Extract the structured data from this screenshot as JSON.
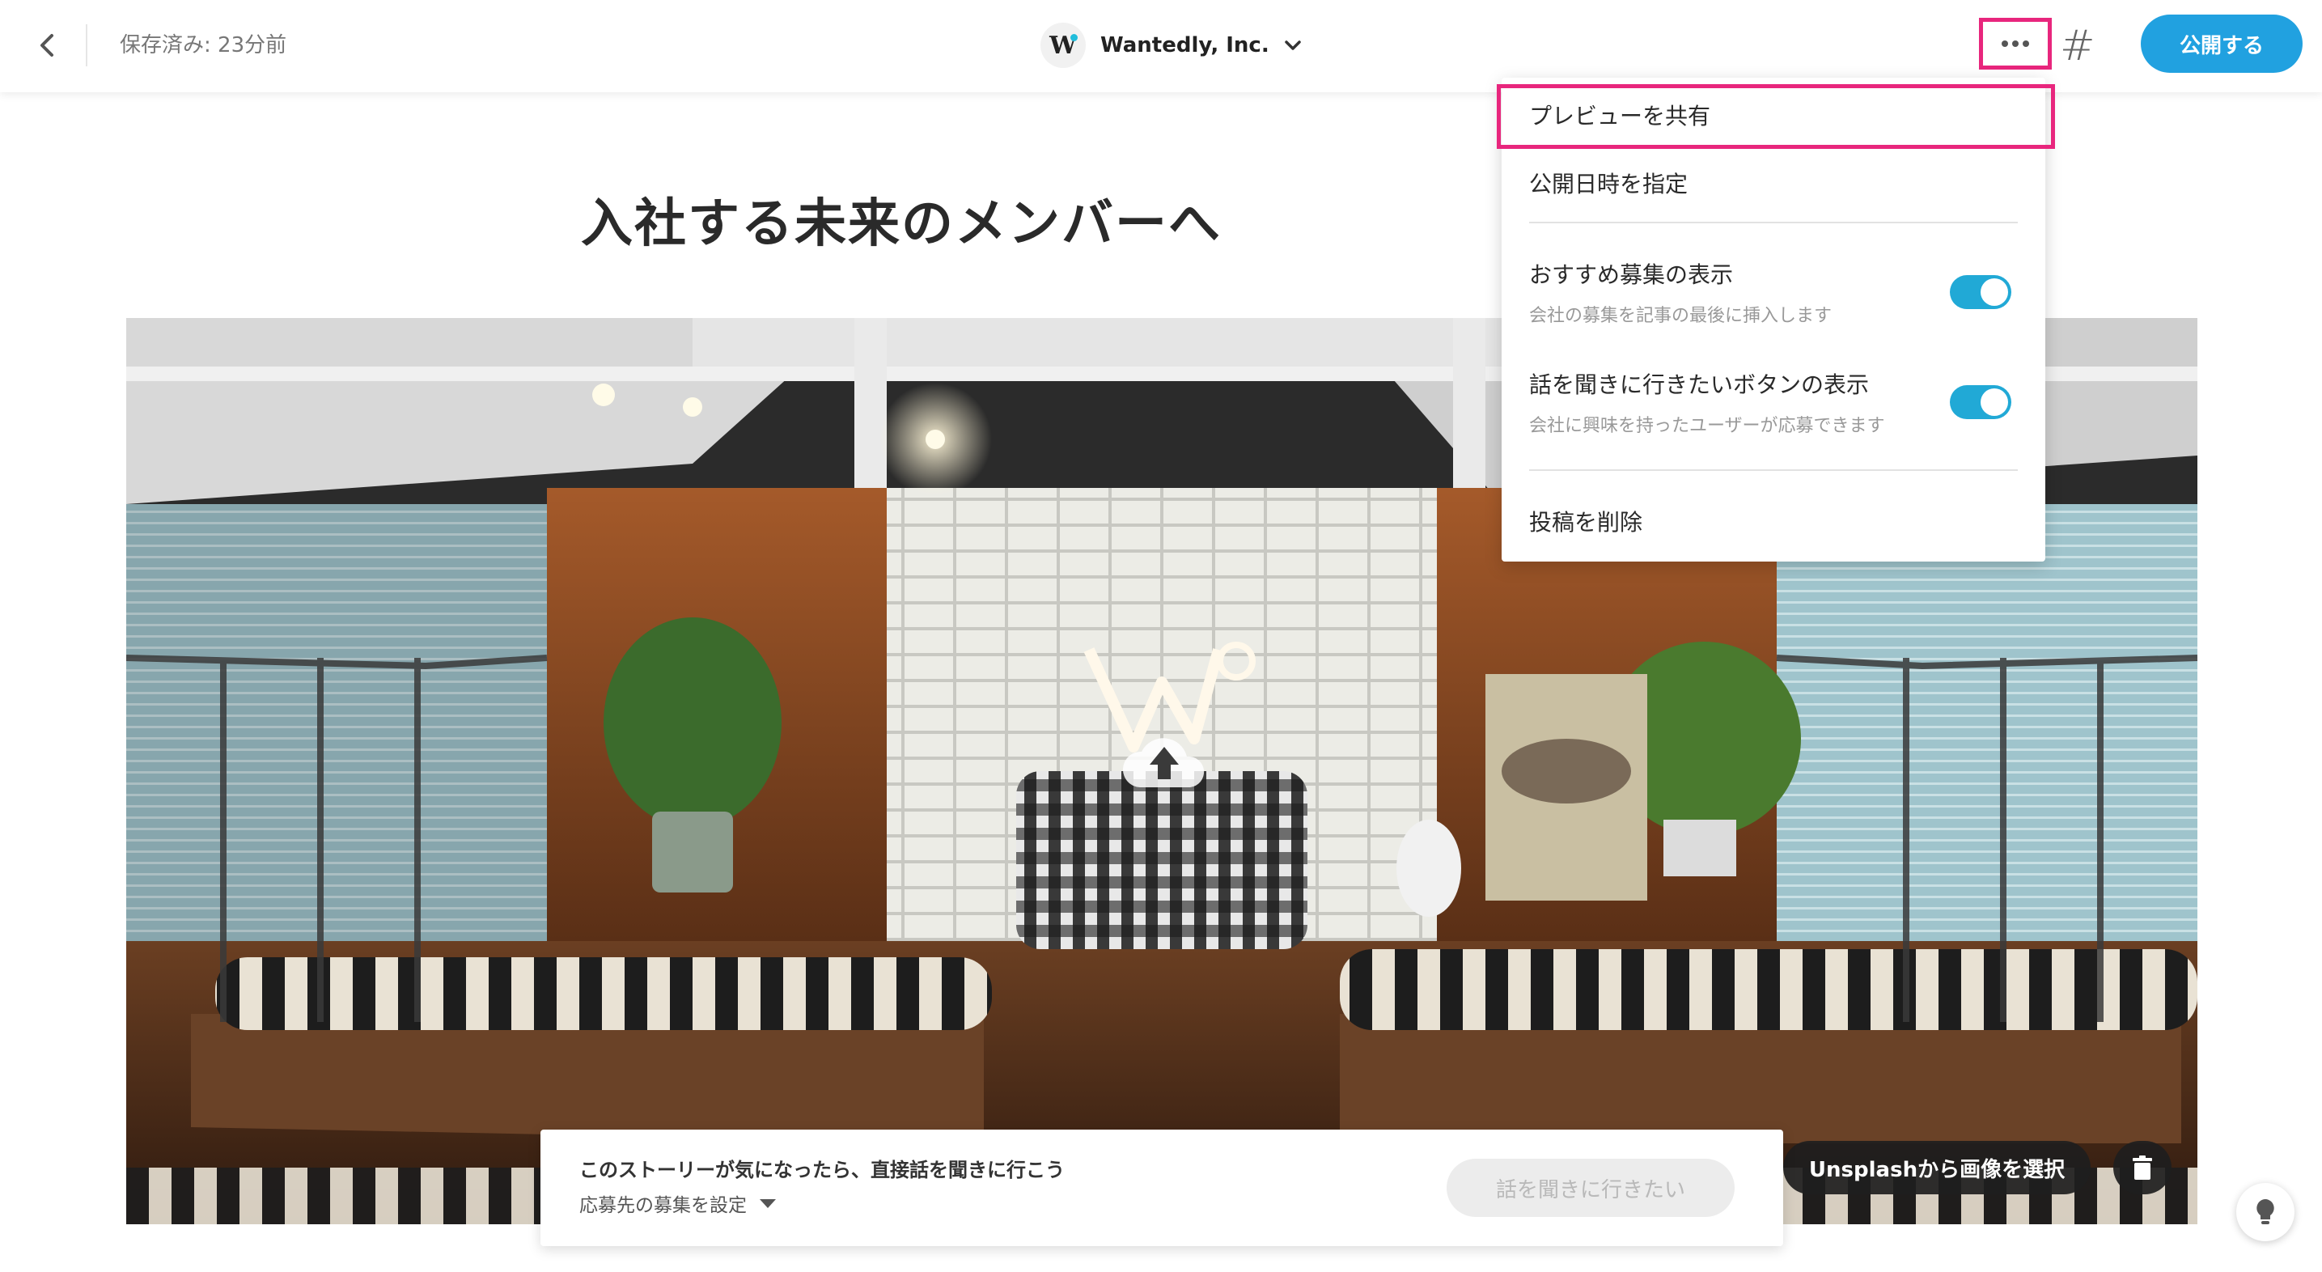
{
  "header": {
    "saved_status": "保存済み: 23分前",
    "company_name": "Wantedly, Inc.",
    "company_logo_letter": "W",
    "publish_label": "公開する",
    "hash_label": "#"
  },
  "story": {
    "title": "入社する未来のメンバーへ"
  },
  "cta": {
    "text": "このストーリーが気になったら、直接話を聞きに行こう",
    "setting_label": "応募先の募集を設定",
    "button_label": "話を聞きに行きたい"
  },
  "cover_actions": {
    "unsplash_label": "Unsplashから画像を選択"
  },
  "menu": {
    "share_preview": "プレビューを共有",
    "schedule_publish": "公開日時を指定",
    "recommend_title": "おすすめ募集の表示",
    "recommend_sub": "会社の募集を記事の最後に挿入します",
    "recommend_enabled": true,
    "talk_button_title": "話を聞きに行きたいボタンの表示",
    "talk_button_sub": "会社に興味を持ったユーザーが応募できます",
    "talk_button_enabled": true,
    "delete_post": "投稿を削除"
  },
  "colors": {
    "accent_blue": "#21a1e0",
    "toggle_blue": "#21a9d6",
    "highlight_pink": "#e8267d"
  },
  "icons": [
    "chevron-left-icon",
    "chevron-down-icon",
    "more-icon",
    "hash-icon",
    "cloud-upload-icon",
    "trash-icon",
    "lightbulb-icon"
  ]
}
